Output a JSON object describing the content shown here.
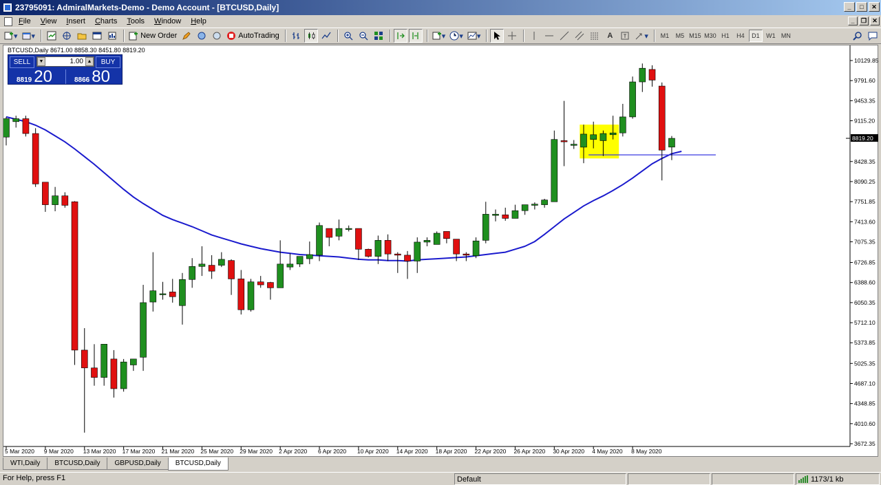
{
  "window": {
    "title": "23795091: AdmiralMarkets-Demo - Demo Account - [BTCUSD,Daily]"
  },
  "menu": [
    "File",
    "View",
    "Insert",
    "Charts",
    "Tools",
    "Window",
    "Help"
  ],
  "toolbar": {
    "new_order": "New Order",
    "autotrading": "AutoTrading",
    "timeframes": [
      "M1",
      "M5",
      "M15",
      "M30",
      "H1",
      "H4",
      "D1",
      "W1",
      "MN"
    ],
    "active_timeframe": "D1"
  },
  "chart": {
    "info": "BTCUSD,Daily  8671.00 8858.30 8451.80 8819.20",
    "current_price": "8819.20",
    "price_labels": [
      "10129.85",
      "9791.60",
      "9453.35",
      "9115.20",
      "8428.35",
      "8090.25",
      "7751.85",
      "7413.60",
      "7075.35",
      "6726.85",
      "6388.60",
      "6050.35",
      "5712.10",
      "5373.85",
      "5025.35",
      "4687.10",
      "4348.85",
      "4010.60",
      "3672.35"
    ],
    "date_labels": [
      "5 Mar 2020",
      "9 Mar 2020",
      "13 Mar 2020",
      "17 Mar 2020",
      "21 Mar 2020",
      "25 Mar 2020",
      "29 Mar 2020",
      "2 Apr 2020",
      "6 Apr 2020",
      "10 Apr 2020",
      "14 Apr 2020",
      "18 Apr 2020",
      "22 Apr 2020",
      "26 Apr 2020",
      "30 Apr 2020",
      "4 May 2020",
      "8 May 2020"
    ],
    "colors": {
      "bull": "#1f8f1f",
      "bear": "#e01010",
      "ma": "#1a1acd",
      "highlight": "#ffff00",
      "hline": "#3a3ae0"
    },
    "candles": [
      {
        "o": 8840,
        "h": 9180,
        "l": 8700,
        "c": 9150
      },
      {
        "o": 9100,
        "h": 9200,
        "l": 9000,
        "c": 9150
      },
      {
        "o": 9150,
        "h": 9200,
        "l": 8850,
        "c": 8900
      },
      {
        "o": 8900,
        "h": 8990,
        "l": 8000,
        "c": 8050
      },
      {
        "o": 8080,
        "h": 8080,
        "l": 7580,
        "c": 7700
      },
      {
        "o": 7700,
        "h": 8000,
        "l": 7590,
        "c": 7850
      },
      {
        "o": 7850,
        "h": 7910,
        "l": 7650,
        "c": 7690
      },
      {
        "o": 7750,
        "h": 7760,
        "l": 5000,
        "c": 5250
      },
      {
        "o": 5250,
        "h": 5620,
        "l": 3860,
        "c": 4950
      },
      {
        "o": 4950,
        "h": 5350,
        "l": 4650,
        "c": 4790
      },
      {
        "o": 4790,
        "h": 5350,
        "l": 4650,
        "c": 5350
      },
      {
        "o": 5100,
        "h": 5250,
        "l": 4450,
        "c": 4600
      },
      {
        "o": 4600,
        "h": 5100,
        "l": 4550,
        "c": 5050
      },
      {
        "o": 5000,
        "h": 5100,
        "l": 4900,
        "c": 5100
      },
      {
        "o": 5130,
        "h": 6350,
        "l": 4900,
        "c": 6050
      },
      {
        "o": 6060,
        "h": 6900,
        "l": 5900,
        "c": 6250
      },
      {
        "o": 6200,
        "h": 6400,
        "l": 6100,
        "c": 6200
      },
      {
        "o": 6230,
        "h": 6450,
        "l": 6050,
        "c": 6150
      },
      {
        "o": 6000,
        "h": 6550,
        "l": 5680,
        "c": 6440
      },
      {
        "o": 6440,
        "h": 6800,
        "l": 6300,
        "c": 6660
      },
      {
        "o": 6660,
        "h": 7000,
        "l": 6500,
        "c": 6700
      },
      {
        "o": 6680,
        "h": 6850,
        "l": 6450,
        "c": 6580
      },
      {
        "o": 6680,
        "h": 6900,
        "l": 6650,
        "c": 6780
      },
      {
        "o": 6760,
        "h": 6780,
        "l": 6180,
        "c": 6450
      },
      {
        "o": 6450,
        "h": 6600,
        "l": 5850,
        "c": 5930
      },
      {
        "o": 5930,
        "h": 6450,
        "l": 5900,
        "c": 6400
      },
      {
        "o": 6400,
        "h": 6500,
        "l": 6300,
        "c": 6350
      },
      {
        "o": 6390,
        "h": 6400,
        "l": 6100,
        "c": 6300
      },
      {
        "o": 6300,
        "h": 7100,
        "l": 6300,
        "c": 6700
      },
      {
        "o": 6650,
        "h": 6880,
        "l": 6600,
        "c": 6700
      },
      {
        "o": 6700,
        "h": 6820,
        "l": 6650,
        "c": 6830
      },
      {
        "o": 6790,
        "h": 7080,
        "l": 6700,
        "c": 6860
      },
      {
        "o": 6850,
        "h": 7400,
        "l": 6750,
        "c": 7350
      },
      {
        "o": 7300,
        "h": 7300,
        "l": 7000,
        "c": 7150
      },
      {
        "o": 7170,
        "h": 7450,
        "l": 7100,
        "c": 7300
      },
      {
        "o": 7300,
        "h": 7350,
        "l": 7250,
        "c": 7300
      },
      {
        "o": 7300,
        "h": 7250,
        "l": 6770,
        "c": 6950
      },
      {
        "o": 6950,
        "h": 6960,
        "l": 6810,
        "c": 6830
      },
      {
        "o": 6830,
        "h": 7180,
        "l": 6700,
        "c": 7100
      },
      {
        "o": 7100,
        "h": 7200,
        "l": 6750,
        "c": 6870
      },
      {
        "o": 6870,
        "h": 6900,
        "l": 6550,
        "c": 6850
      },
      {
        "o": 6850,
        "h": 6920,
        "l": 6450,
        "c": 6750
      },
      {
        "o": 6750,
        "h": 7150,
        "l": 6550,
        "c": 7070
      },
      {
        "o": 7070,
        "h": 7150,
        "l": 7000,
        "c": 7100
      },
      {
        "o": 7030,
        "h": 7250,
        "l": 7050,
        "c": 7220
      },
      {
        "o": 7250,
        "h": 7250,
        "l": 7050,
        "c": 7130
      },
      {
        "o": 7120,
        "h": 7120,
        "l": 6750,
        "c": 6870
      },
      {
        "o": 6870,
        "h": 6900,
        "l": 6750,
        "c": 6850
      },
      {
        "o": 6840,
        "h": 7150,
        "l": 6800,
        "c": 7090
      },
      {
        "o": 7100,
        "h": 7750,
        "l": 7050,
        "c": 7540
      },
      {
        "o": 7520,
        "h": 7620,
        "l": 7420,
        "c": 7540
      },
      {
        "o": 7530,
        "h": 7650,
        "l": 7430,
        "c": 7470
      },
      {
        "o": 7470,
        "h": 7700,
        "l": 7470,
        "c": 7600
      },
      {
        "o": 7600,
        "h": 7680,
        "l": 7530,
        "c": 7700
      },
      {
        "o": 7690,
        "h": 7740,
        "l": 7620,
        "c": 7710
      },
      {
        "o": 7700,
        "h": 7800,
        "l": 7650,
        "c": 7780
      },
      {
        "o": 7750,
        "h": 8950,
        "l": 7750,
        "c": 8800
      },
      {
        "o": 8780,
        "h": 9450,
        "l": 8350,
        "c": 8760
      },
      {
        "o": 8700,
        "h": 8790,
        "l": 8640,
        "c": 8720
      },
      {
        "o": 8670,
        "h": 9050,
        "l": 8400,
        "c": 8890
      },
      {
        "o": 8800,
        "h": 9100,
        "l": 8650,
        "c": 8880
      },
      {
        "o": 8780,
        "h": 8950,
        "l": 8520,
        "c": 8900
      },
      {
        "o": 8880,
        "h": 9200,
        "l": 8800,
        "c": 8910
      },
      {
        "o": 8910,
        "h": 9400,
        "l": 8850,
        "c": 9180
      },
      {
        "o": 9180,
        "h": 9860,
        "l": 9150,
        "c": 9770
      },
      {
        "o": 9770,
        "h": 10080,
        "l": 9600,
        "c": 10000
      },
      {
        "o": 9980,
        "h": 10050,
        "l": 9690,
        "c": 9800
      },
      {
        "o": 9700,
        "h": 9760,
        "l": 8110,
        "c": 8620
      },
      {
        "o": 8671,
        "h": 8858.3,
        "l": 8451.8,
        "c": 8819.2
      }
    ],
    "ma": [
      9180,
      9140,
      9100,
      9040,
      8960,
      8860,
      8760,
      8640,
      8510,
      8380,
      8240,
      8100,
      7960,
      7830,
      7720,
      7620,
      7520,
      7450,
      7390,
      7330,
      7260,
      7190,
      7140,
      7090,
      7040,
      7000,
      6960,
      6930,
      6900,
      6880,
      6860,
      6850,
      6840,
      6830,
      6820,
      6800,
      6780,
      6770,
      6770,
      6760,
      6760,
      6750,
      6770,
      6780,
      6790,
      6800,
      6810,
      6820,
      6840,
      6860,
      6880,
      6900,
      6950,
      7000,
      7080,
      7200,
      7330,
      7460,
      7570,
      7680,
      7770,
      7850,
      7940,
      8040,
      8150,
      8270,
      8390,
      8480,
      8560,
      8600
    ],
    "hline": 8540,
    "ymin": 3672.35,
    "ymax": 10129.85
  },
  "trade_panel": {
    "sell_label": "SELL",
    "buy_label": "BUY",
    "volume": "1.00",
    "sell_small": "8819",
    "sell_big": "20",
    "buy_small": "8866",
    "buy_big": "80"
  },
  "tabs": [
    "WTI,Daily",
    "BTCUSD,Daily",
    "GBPUSD,Daily",
    "BTCUSD,Daily"
  ],
  "active_tab": 3,
  "status": {
    "help": "For Help, press F1",
    "profile": "Default",
    "traffic": "1173/1 kb"
  }
}
